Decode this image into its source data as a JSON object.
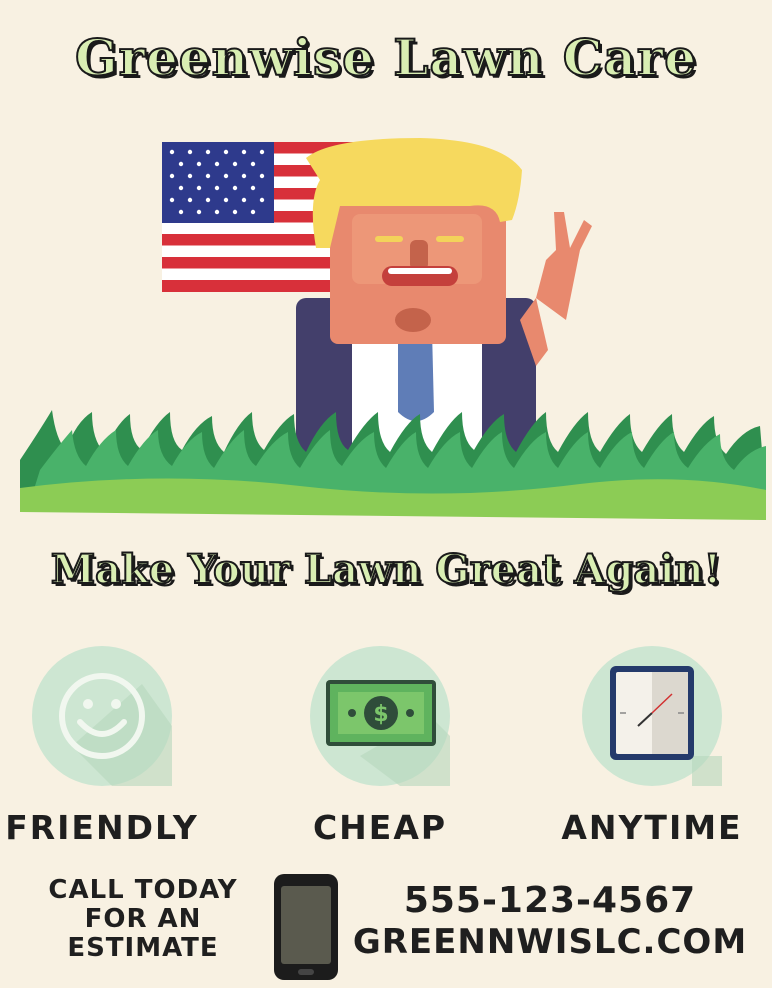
{
  "header": {
    "title": "Greenwise Lawn Care"
  },
  "tagline": "Make Your Lawn Great Again!",
  "features": [
    {
      "label": "FRIENDLY",
      "icon": "smiley-icon"
    },
    {
      "label": "CHEAP",
      "icon": "money-icon"
    },
    {
      "label": "ANYTIME",
      "icon": "clock-icon"
    }
  ],
  "contact": {
    "cta_lines": [
      "CALL TODAY",
      "FOR AN",
      "ESTIMATE"
    ],
    "phone": "555-123-4567",
    "website": "GREENNWISLC.COM",
    "icon": "phone-icon"
  },
  "colors": {
    "background": "#f8f1e2",
    "title_fill": "#d9eeb3",
    "icon_circle": "#cde6d2",
    "grass": "#3aa35a"
  }
}
